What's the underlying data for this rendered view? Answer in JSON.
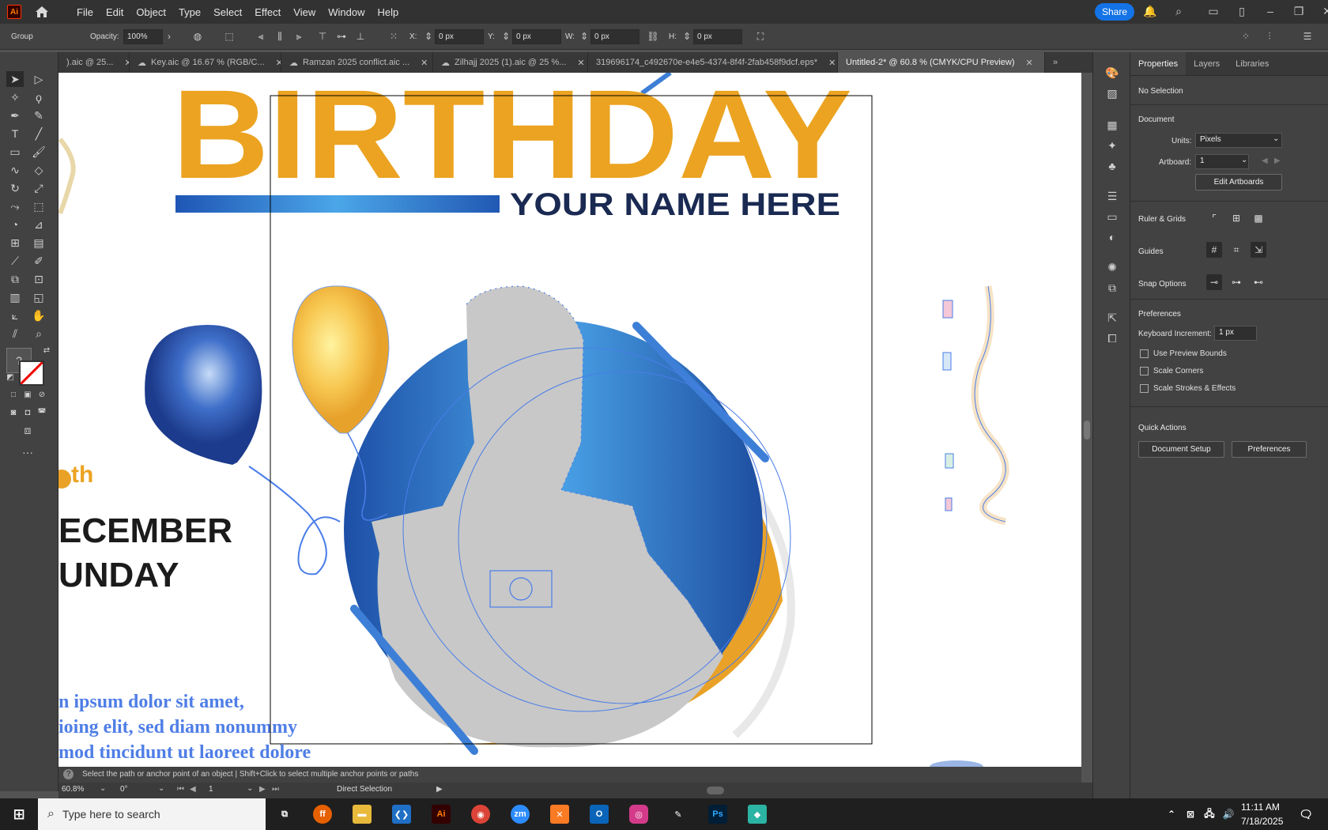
{
  "app": {
    "logo": "Ai",
    "menus": [
      "File",
      "Edit",
      "Object",
      "Type",
      "Select",
      "Effect",
      "View",
      "Window",
      "Help"
    ],
    "share_label": "Share"
  },
  "control": {
    "selection_label": "Group",
    "opacity_label": "Opacity:",
    "opacity_value": "100%",
    "x_label": "X:",
    "x_value": "0 px",
    "y_label": "Y:",
    "y_value": "0 px",
    "w_label": "W:",
    "w_value": "0 px",
    "h_label": "H:",
    "h_value": "0 px"
  },
  "tabs": [
    {
      "label": ").aic @ 25..."
    },
    {
      "label": "Key.aic @ 16.67 % (RGB/C..."
    },
    {
      "label": "Ramzan 2025 conflict.aic ..."
    },
    {
      "label": "Zilhajj 2025 (1).aic @ 25 %..."
    },
    {
      "label": "319696174_c492670e-e4e5-4374-8f4f-2fab458f9dcf.eps*"
    },
    {
      "label": "Untitled-2* @ 60.8 % (CMYK/CPU Preview)"
    }
  ],
  "artwork": {
    "headline": "BIRTHDAY",
    "name_line": "YOUR NAME HERE",
    "date_suffix": "th",
    "month": "ECEMBER",
    "weekday": "UNDAY",
    "body_lines": [
      "n ipsum dolor sit amet,",
      "ioing elit, sed diam nonummy",
      "mod tincidunt ut laoreet dolore"
    ]
  },
  "status": {
    "hint": "Select the path or anchor point of an object  |  Shift+Click to select multiple anchor points or paths",
    "zoom": "60.8%",
    "rotation": "0°",
    "artboard": "1",
    "tool": "Direct Selection"
  },
  "properties": {
    "tabs": [
      "Properties",
      "Layers",
      "Libraries"
    ],
    "selection": "No Selection",
    "document_title": "Document",
    "units_label": "Units:",
    "units_value": "Pixels",
    "artboard_label": "Artboard:",
    "artboard_value": "1",
    "edit_artboards": "Edit Artboards",
    "ruler_grids": "Ruler & Grids",
    "guides": "Guides",
    "snap_options": "Snap Options",
    "preferences_title": "Preferences",
    "keyboard_increment_label": "Keyboard Increment:",
    "keyboard_increment_value": "1 px",
    "use_preview_bounds": "Use Preview Bounds",
    "scale_corners": "Scale Corners",
    "scale_strokes": "Scale Strokes & Effects",
    "quick_actions": "Quick Actions",
    "document_setup": "Document Setup",
    "preferences_btn": "Preferences"
  },
  "taskbar": {
    "search_placeholder": "Type here to search",
    "time": "11:11 AM",
    "date": "7/18/2025"
  },
  "colors": {
    "accent": "#1473e6",
    "orange": "#eba321",
    "blue": "#2d6fd1",
    "selection": "#4a7de8"
  }
}
